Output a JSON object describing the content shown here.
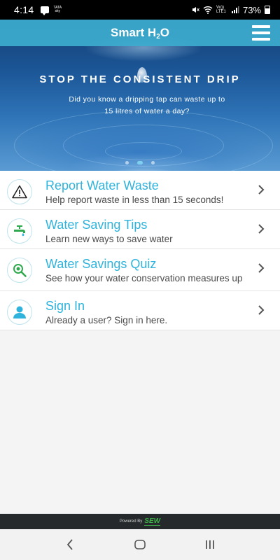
{
  "status_bar": {
    "time": "4:14",
    "carrier_line1": "TATA",
    "carrier_line2": "sky",
    "network": "Vo)) LTE1",
    "battery": "73%",
    "icons": [
      "message-icon",
      "wifi-icon",
      "mute-icon",
      "signal-icon",
      "battery-icon"
    ]
  },
  "header": {
    "title_main": "Smart H",
    "title_sub": "2",
    "title_end": "O",
    "menu_icon": "hamburger-menu-icon"
  },
  "hero": {
    "headline": "STOP THE CONSISTENT DRIP",
    "subtext_line1": "Did you know a dripping tap can waste up to",
    "subtext_line2": "15 litres of water a day?",
    "slides_count": 3,
    "active_slide": 2
  },
  "menu": {
    "items": [
      {
        "title": "Report Water Waste",
        "subtitle": "Help report waste in less than 15 seconds!",
        "icon": "warning-icon"
      },
      {
        "title": "Water Saving Tips",
        "subtitle": "Learn new ways to save water",
        "icon": "tap-icon"
      },
      {
        "title": "Water Savings Quiz",
        "subtitle": "See how your water conservation measures up",
        "icon": "magnifier-icon"
      },
      {
        "title": "Sign In",
        "subtitle": "Already a user? Sign in here.",
        "icon": "user-icon"
      }
    ]
  },
  "footer": {
    "powered_by": "Powered By",
    "brand": "SEW"
  },
  "nav_bar": {
    "icons": [
      "back-icon",
      "home-icon",
      "recents-icon"
    ]
  },
  "colors": {
    "accent": "#3dabce",
    "title_text": "#2fb3dc",
    "icon_green": "#2ea84d",
    "footer_bg": "#25292c"
  }
}
